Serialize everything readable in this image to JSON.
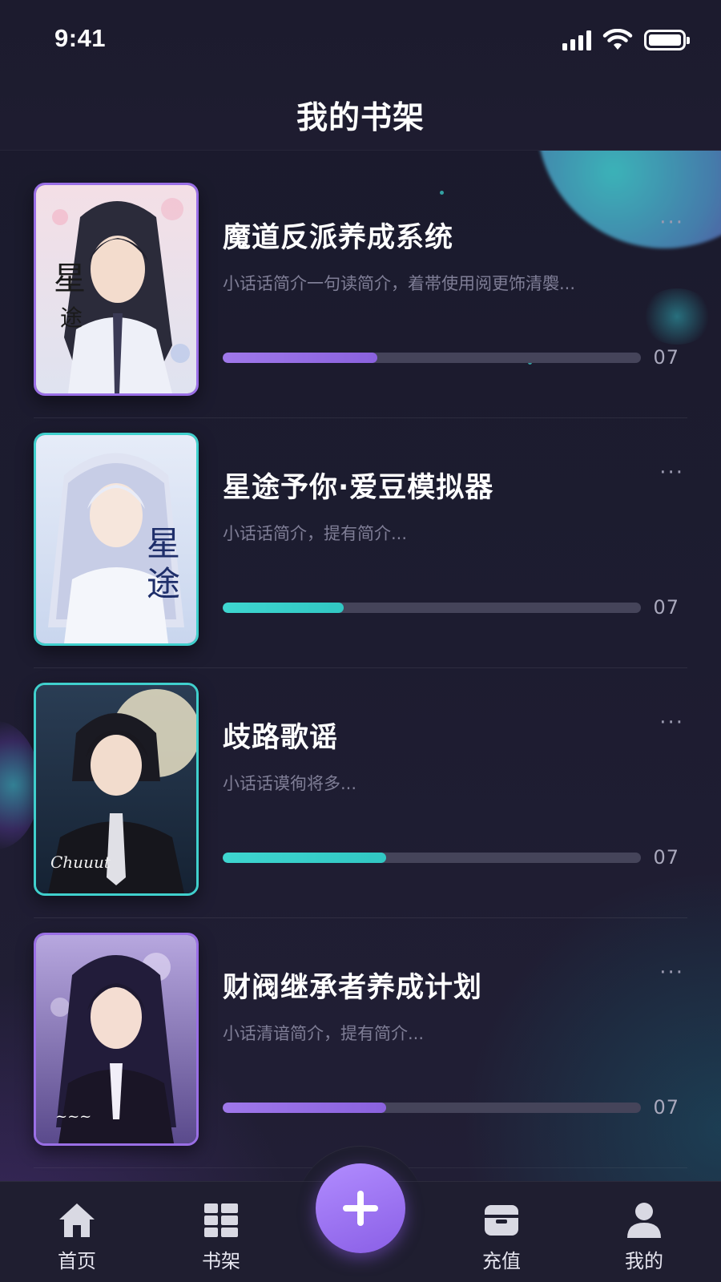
{
  "status_bar": {
    "time": "9:41"
  },
  "header": {
    "title": "我的书架"
  },
  "books": [
    {
      "title": "魔道反派养成系统",
      "description": "小话话简介一句读简介，着帯使用阅更饰清褜...",
      "progress_value": "07",
      "progress_fraction": 0.37,
      "accent": "#9a6fe6",
      "cover_icon": "cover-image-white-robed-swordsman"
    },
    {
      "title": "星途予你·爱豆模拟器",
      "description": "小话话简介，提有简介...",
      "progress_value": "07",
      "progress_fraction": 0.29,
      "accent": "#40d0cd",
      "cover_icon": "cover-image-silver-haired-idol"
    },
    {
      "title": "歧路歌谣",
      "description": "小话话谟徇将多...",
      "progress_value": "07",
      "progress_fraction": 0.39,
      "accent": "#40d0cd",
      "cover_icon": "cover-image-suited-man-moonlight"
    },
    {
      "title": "财阀继承者养成计划",
      "description": "小话清谙简介，提有简介...",
      "progress_value": "07",
      "progress_fraction": 0.39,
      "accent": "#9a6fe6",
      "cover_icon": "cover-image-dark-haired-heiress"
    }
  ],
  "more_label": "···",
  "tab_bar": {
    "home": "首页",
    "shelf": "书架",
    "recharge": "充值",
    "mine": "我的",
    "fab_icon": "plus-icon"
  }
}
